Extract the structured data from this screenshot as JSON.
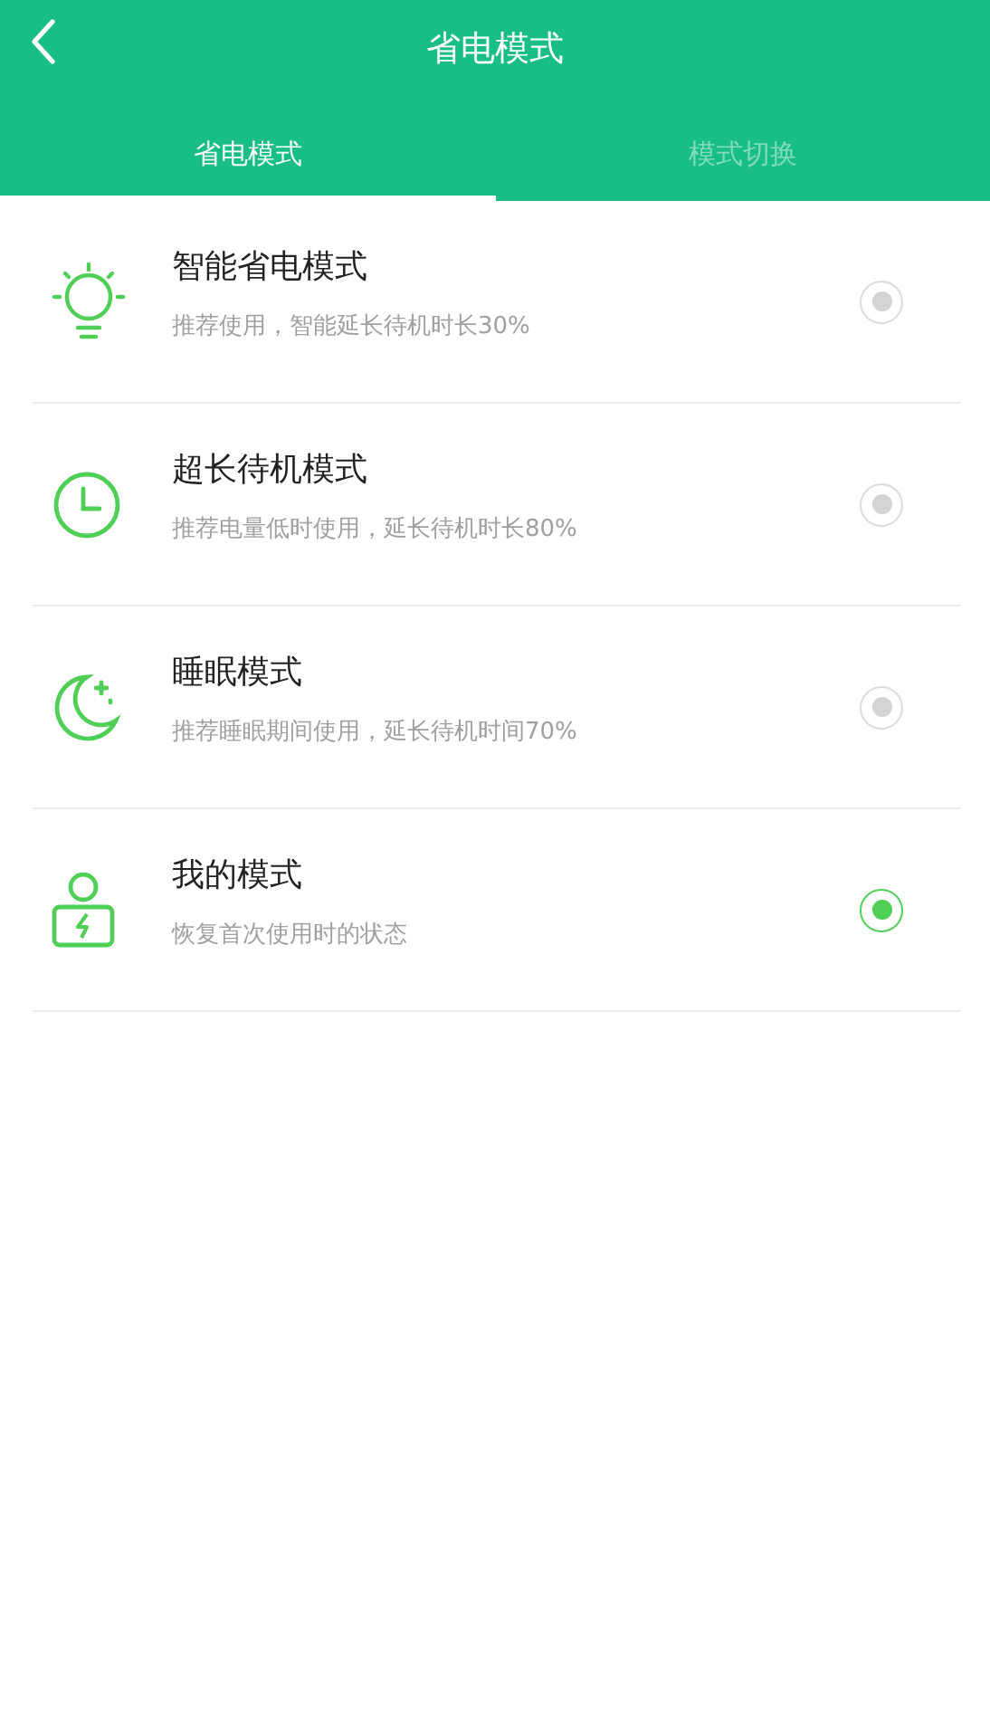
{
  "header": {
    "title": "省电模式"
  },
  "tabs": [
    {
      "label": "省电模式",
      "selected": true
    },
    {
      "label": "模式切换",
      "selected": false
    }
  ],
  "modes": [
    {
      "kind": "bulb",
      "title": "智能省电模式",
      "description": "推荐使用，智能延长待机时长30%",
      "selected": false
    },
    {
      "kind": "clock",
      "title": "超长待机模式",
      "description": "推荐电量低时使用，延长待机时长80%",
      "selected": false
    },
    {
      "kind": "moon",
      "title": "睡眠模式",
      "description": "推荐睡眠期间使用，延长待机时间70%",
      "selected": false
    },
    {
      "kind": "user",
      "title": "我的模式",
      "description": "恢复首次使用时的状态",
      "selected": true
    }
  ]
}
